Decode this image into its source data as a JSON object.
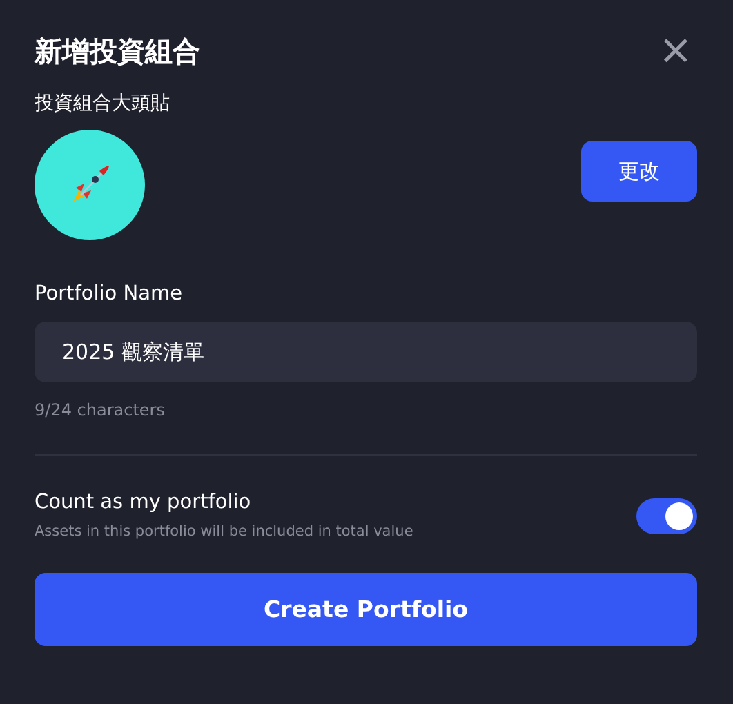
{
  "dialog": {
    "title": "新增投資組合",
    "close": "×"
  },
  "avatar": {
    "label": "投資組合大頭貼",
    "color": "#40e8dc",
    "change_button": "更改"
  },
  "name_field": {
    "label": "Portfolio Name",
    "value": "2025 觀察清單",
    "counter": "9/24 characters"
  },
  "count_toggle": {
    "label": "Count as my portfolio",
    "description": "Assets in this portfolio will be included in total value",
    "on": true
  },
  "submit_button": "Create Portfolio"
}
